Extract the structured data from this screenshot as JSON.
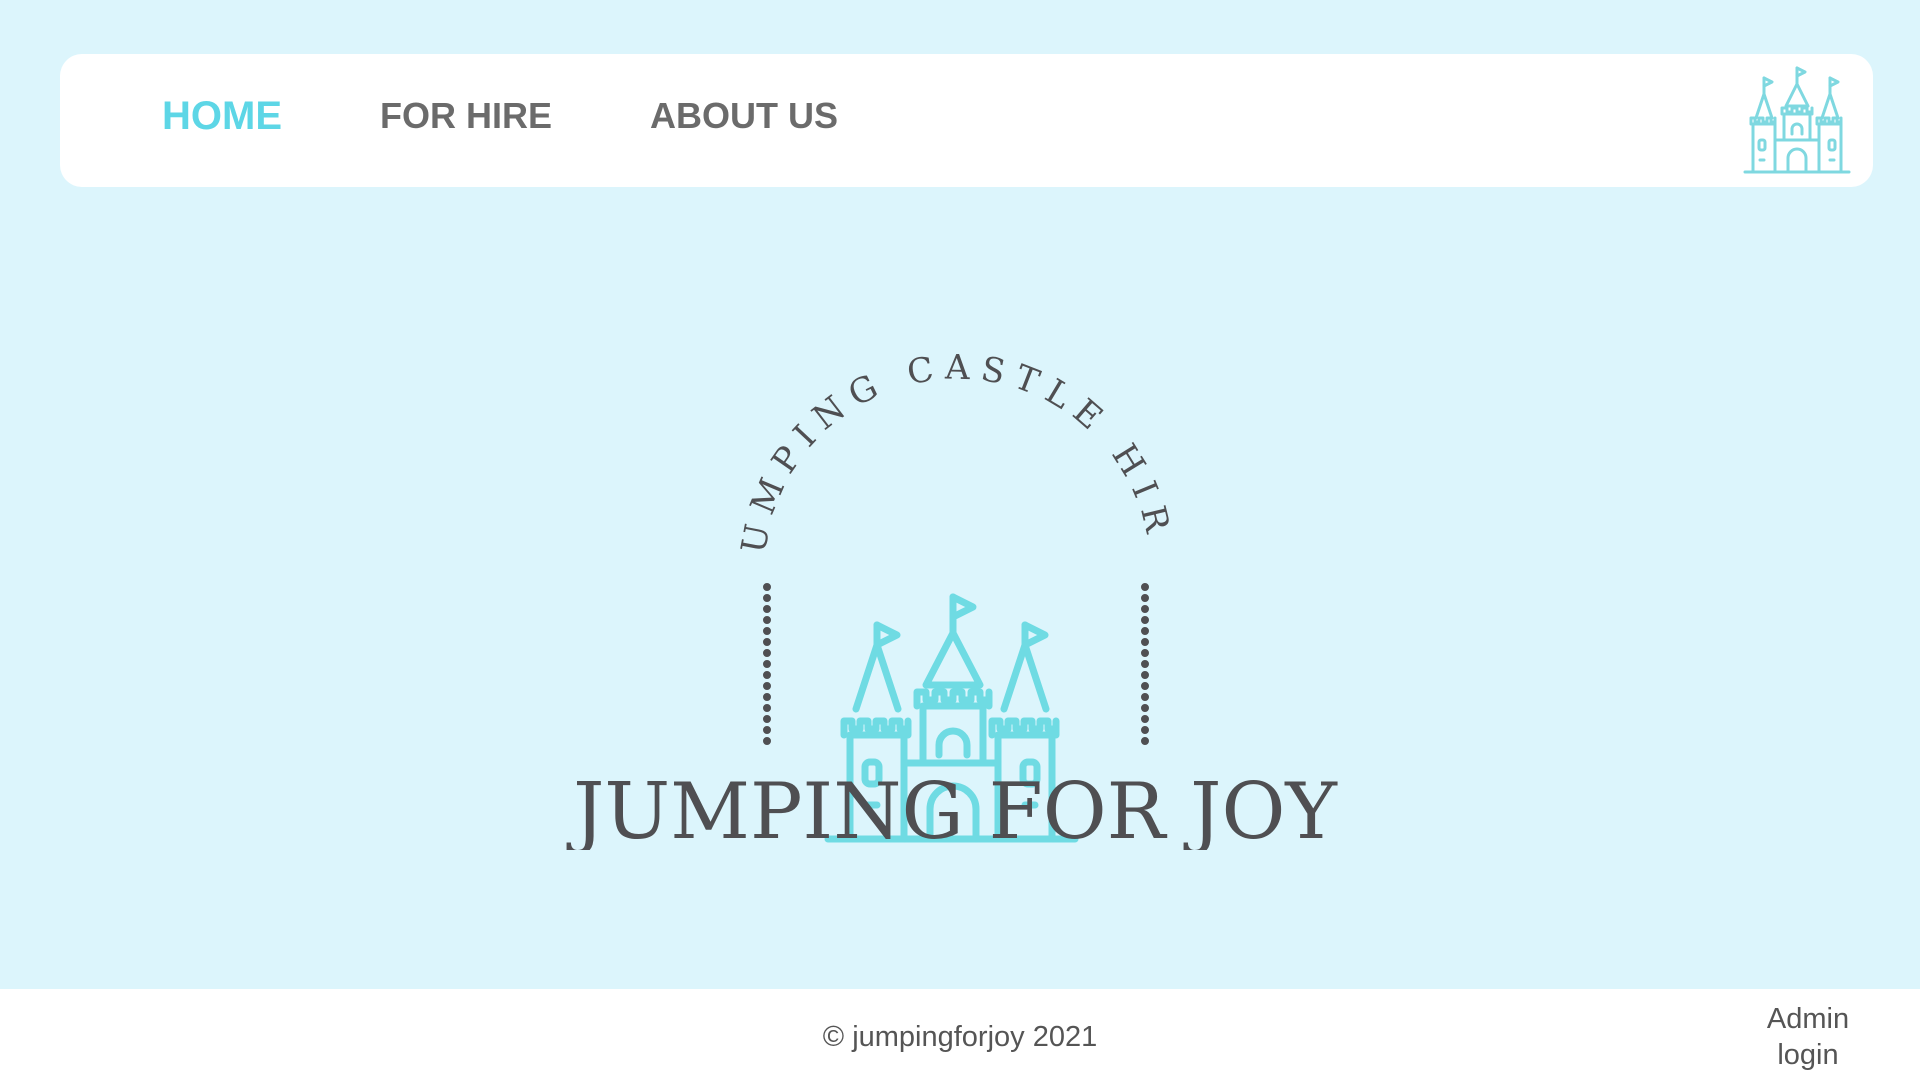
{
  "nav": {
    "items": [
      {
        "label": "HOME",
        "active": true
      },
      {
        "label": "FOR HIRE",
        "active": false
      },
      {
        "label": "ABOUT US",
        "active": false
      }
    ],
    "logo_icon": "castle-icon"
  },
  "hero": {
    "arc_text": "JUMPING CASTLE HIRE",
    "title": "JUMPING FOR JOY",
    "icon": "castle-icon"
  },
  "footer": {
    "copyright": "© jumpingforjoy 2021",
    "admin_line1": "Admin",
    "admin_line2": "login"
  },
  "colors": {
    "background": "#dcf5fc",
    "accent": "#5dd6e6",
    "nav_text": "#6b6b6b",
    "brand_text": "#4f4f52",
    "panel": "#ffffff"
  }
}
